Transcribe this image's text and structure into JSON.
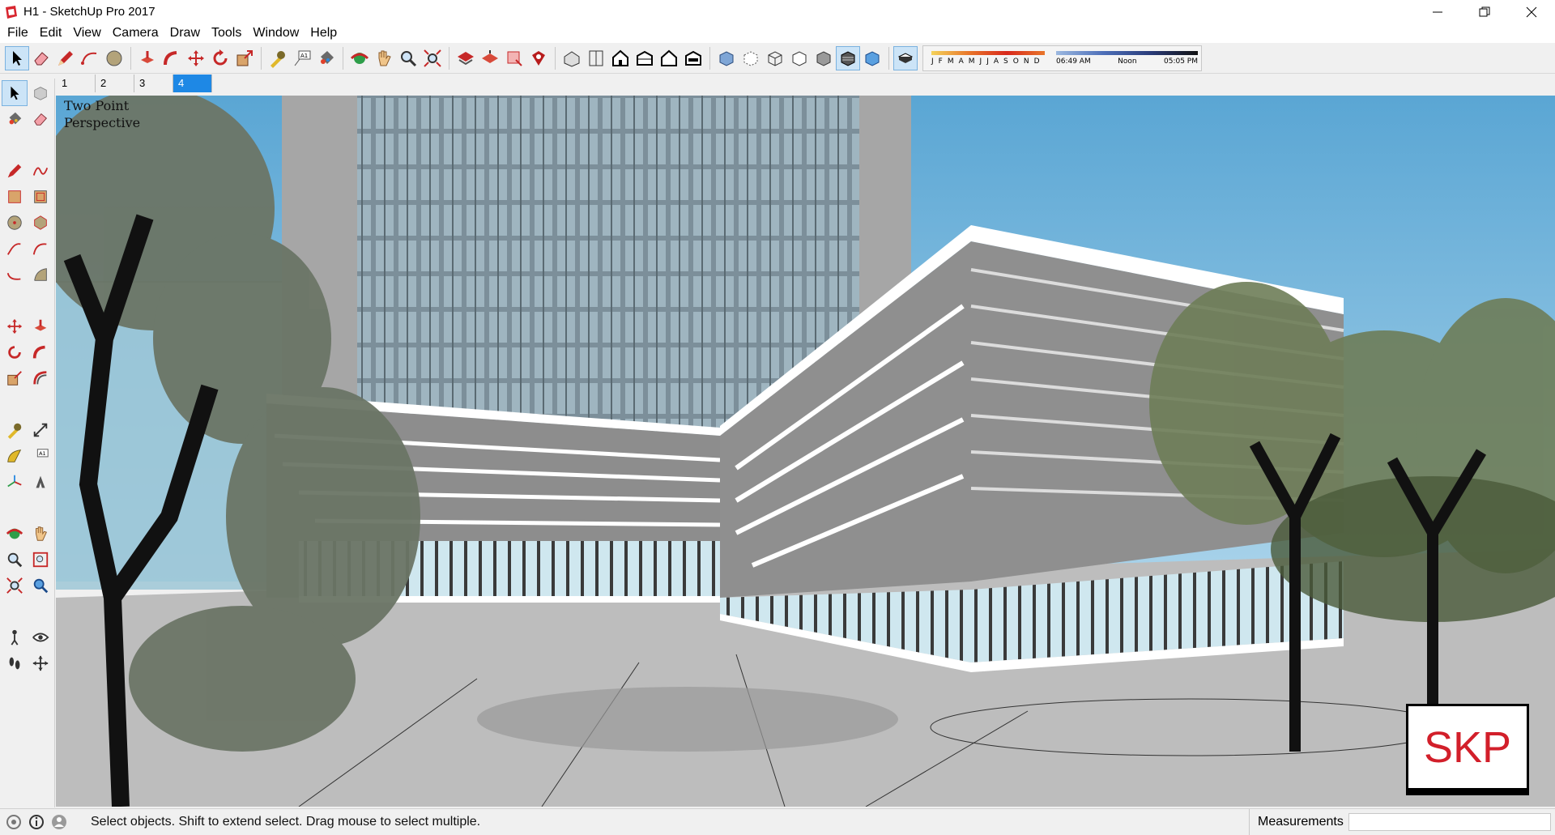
{
  "window": {
    "title": "H1 - SketchUp Pro 2017"
  },
  "menu": [
    "File",
    "Edit",
    "View",
    "Camera",
    "Draw",
    "Tools",
    "Window",
    "Help"
  ],
  "shadow": {
    "months": [
      "J",
      "F",
      "M",
      "A",
      "M",
      "J",
      "J",
      "A",
      "S",
      "O",
      "N",
      "D"
    ],
    "time_start": "06:49 AM",
    "time_mid": "Noon",
    "time_end": "05:05 PM"
  },
  "scenes": {
    "tabs": [
      "1",
      "2",
      "3",
      "4"
    ],
    "active": "4"
  },
  "viewport": {
    "camera_label": "Two Point Perspective",
    "watermark": "SKP"
  },
  "status": {
    "hint": "Select objects. Shift to extend select. Drag mouse to select multiple.",
    "measurements_label": "Measurements",
    "measurements_value": ""
  },
  "colors": {
    "accent": "#1e88e5",
    "sky": "#5aa6d4",
    "ground": "#bdbdbd",
    "skp_red": "#d21f2a"
  }
}
